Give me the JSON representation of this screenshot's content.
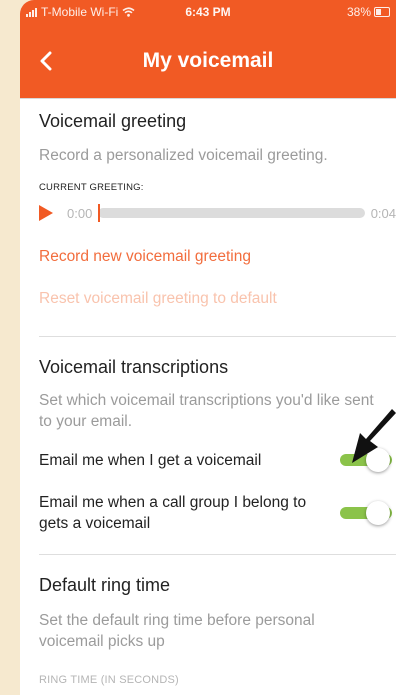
{
  "status": {
    "carrier": "T-Mobile Wi-Fi",
    "time": "6:43 PM",
    "battery": "38%"
  },
  "header": {
    "title": "My voicemail"
  },
  "greeting": {
    "heading": "Voicemail greeting",
    "description": "Record a personalized voicemail greeting.",
    "current_label": "CURRENT GREETING:",
    "start_time": "0:00",
    "end_time": "0:04",
    "progress": 0,
    "record_link": "Record new voicemail greeting",
    "reset_link": "Reset voicemail greeting to default"
  },
  "transcriptions": {
    "heading": "Voicemail transcriptions",
    "description": "Set which voicemail transcriptions you'd like sent to your email.",
    "options": [
      {
        "label": "Email me when I get a voicemail",
        "enabled": true
      },
      {
        "label": "Email me when a call group I belong to gets a voicemail",
        "enabled": true
      }
    ]
  },
  "ring": {
    "heading": "Default ring time",
    "description": "Set the default ring time before personal voicemail picks up",
    "field_label": "RING TIME (IN SECONDS)"
  },
  "colors": {
    "accent": "#f15a24",
    "toggle_on": "#8bc34a",
    "background": "#f6e9cf"
  },
  "icons": {
    "back": "chevron-left-icon",
    "wifi": "wifi-icon",
    "signal": "signal-icon",
    "battery": "battery-icon",
    "play": "play-icon",
    "annotation": "arrow-pointer-icon"
  }
}
